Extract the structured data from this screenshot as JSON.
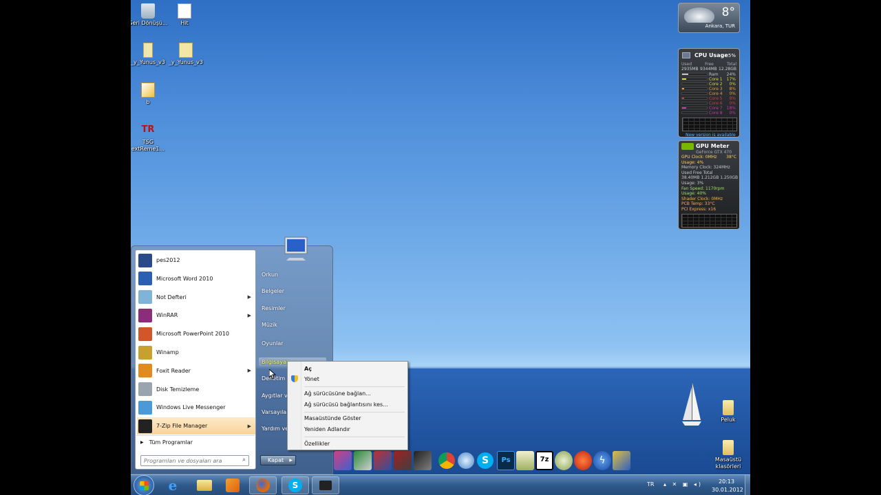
{
  "desktop": {
    "icons": [
      {
        "label": "Geri Dönüşü...",
        "icon": "recycle-bin-icon"
      },
      {
        "label": "Hit",
        "icon": "text-file-icon"
      },
      {
        "label": "_y_Yunus_v3",
        "icon": "file-icon"
      },
      {
        "label": "_y_Yunus_v3",
        "icon": "7zip-file-icon"
      },
      {
        "label": "b",
        "icon": "pdf-file-icon"
      },
      {
        "label": "TSG extReme1...",
        "icon": "tsg-icon"
      },
      {
        "label": "Peluk",
        "icon": "folder-icon"
      },
      {
        "label": "Masaüstü klasörleri",
        "icon": "folder-icon"
      }
    ]
  },
  "weather_gadget": {
    "temp": "8°",
    "location": "Ankara, TUR"
  },
  "cpu_gadget": {
    "title": "CPU Usage",
    "percent": "5%",
    "headers": [
      "Used",
      "Free",
      "Total"
    ],
    "values": [
      "2935MB",
      "9344MB",
      "12.28GB"
    ],
    "rows": [
      {
        "label": "Ram",
        "value": "24%",
        "color": "#c8c8c8"
      },
      {
        "label": "Core 1",
        "value": "17%",
        "color": "#d8d84a"
      },
      {
        "label": "Core 2",
        "value": "0%",
        "color": "#d8d84a"
      },
      {
        "label": "Core 3",
        "value": "8%",
        "color": "#e0a040"
      },
      {
        "label": "Core 4",
        "value": "0%",
        "color": "#e0a040"
      },
      {
        "label": "Core 5",
        "value": "8%",
        "color": "#c04040"
      },
      {
        "label": "Core 6",
        "value": "0%",
        "color": "#c04040"
      },
      {
        "label": "Core 7",
        "value": "18%",
        "color": "#c03aa0"
      },
      {
        "label": "Core 8",
        "value": "0%",
        "color": "#c03aa0"
      }
    ],
    "footer": "New version is available"
  },
  "gpu_gadget": {
    "title": "GPU Meter",
    "model": "GeForce GTX 470",
    "lines": [
      "GPU Clock: 0MHz",
      "Usage: 4%",
      "Memory Clock: 324MHz",
      "Used Free Total",
      "38.40MB 1.212GB 1.250GB",
      "Usage: 3%",
      "Fan Speed: 1170rpm",
      "Usage: 40%",
      "Shader Clock: 0MHz",
      "PCB Temp: 33°C",
      "PCI Express: x16"
    ],
    "temp": "38°C"
  },
  "start_menu": {
    "programs": [
      {
        "label": "pes2012",
        "color": "#2a4a8a",
        "has_arrow": false
      },
      {
        "label": "Microsoft Word 2010",
        "color": "#2b5fb4",
        "has_arrow": false
      },
      {
        "label": "Not Defteri",
        "color": "#7fb3d8",
        "has_arrow": true
      },
      {
        "label": "WinRAR",
        "color": "#8b2d7a",
        "has_arrow": true
      },
      {
        "label": "Microsoft PowerPoint 2010",
        "color": "#d2562a",
        "has_arrow": false
      },
      {
        "label": "Winamp",
        "color": "#c8a030",
        "has_arrow": false
      },
      {
        "label": "Foxit Reader",
        "color": "#e08a20",
        "has_arrow": true
      },
      {
        "label": "Disk Temizleme",
        "color": "#9aa4b0",
        "has_arrow": false
      },
      {
        "label": "Windows Live Messenger",
        "color": "#4a9ad8",
        "has_arrow": false
      },
      {
        "label": "7-Zip File Manager",
        "color": "#222222",
        "has_arrow": true
      }
    ],
    "all_programs": "Tüm Programlar",
    "search_placeholder": "Programları ve dosyaları ara",
    "right_links": [
      "Orkun",
      "Belgeler",
      "Resimler",
      "Müzik",
      "Oyunlar",
      "Bilgisayar",
      "Denetim",
      "Aygıtlar ve",
      "Varsayılan",
      "Yardım ve"
    ],
    "shutdown": "Kapat"
  },
  "context_menu": {
    "items": [
      "Aç",
      "Yönet",
      "Ağ sürücüsüne bağlan...",
      "Ağ sürücüsü bağlantısını kes...",
      "Masaüstünde Göster",
      "Yeniden Adlandır",
      "Özellikler"
    ]
  },
  "taskbar": {
    "language": "TR",
    "time": "20:13",
    "date": "30.01.2012"
  }
}
